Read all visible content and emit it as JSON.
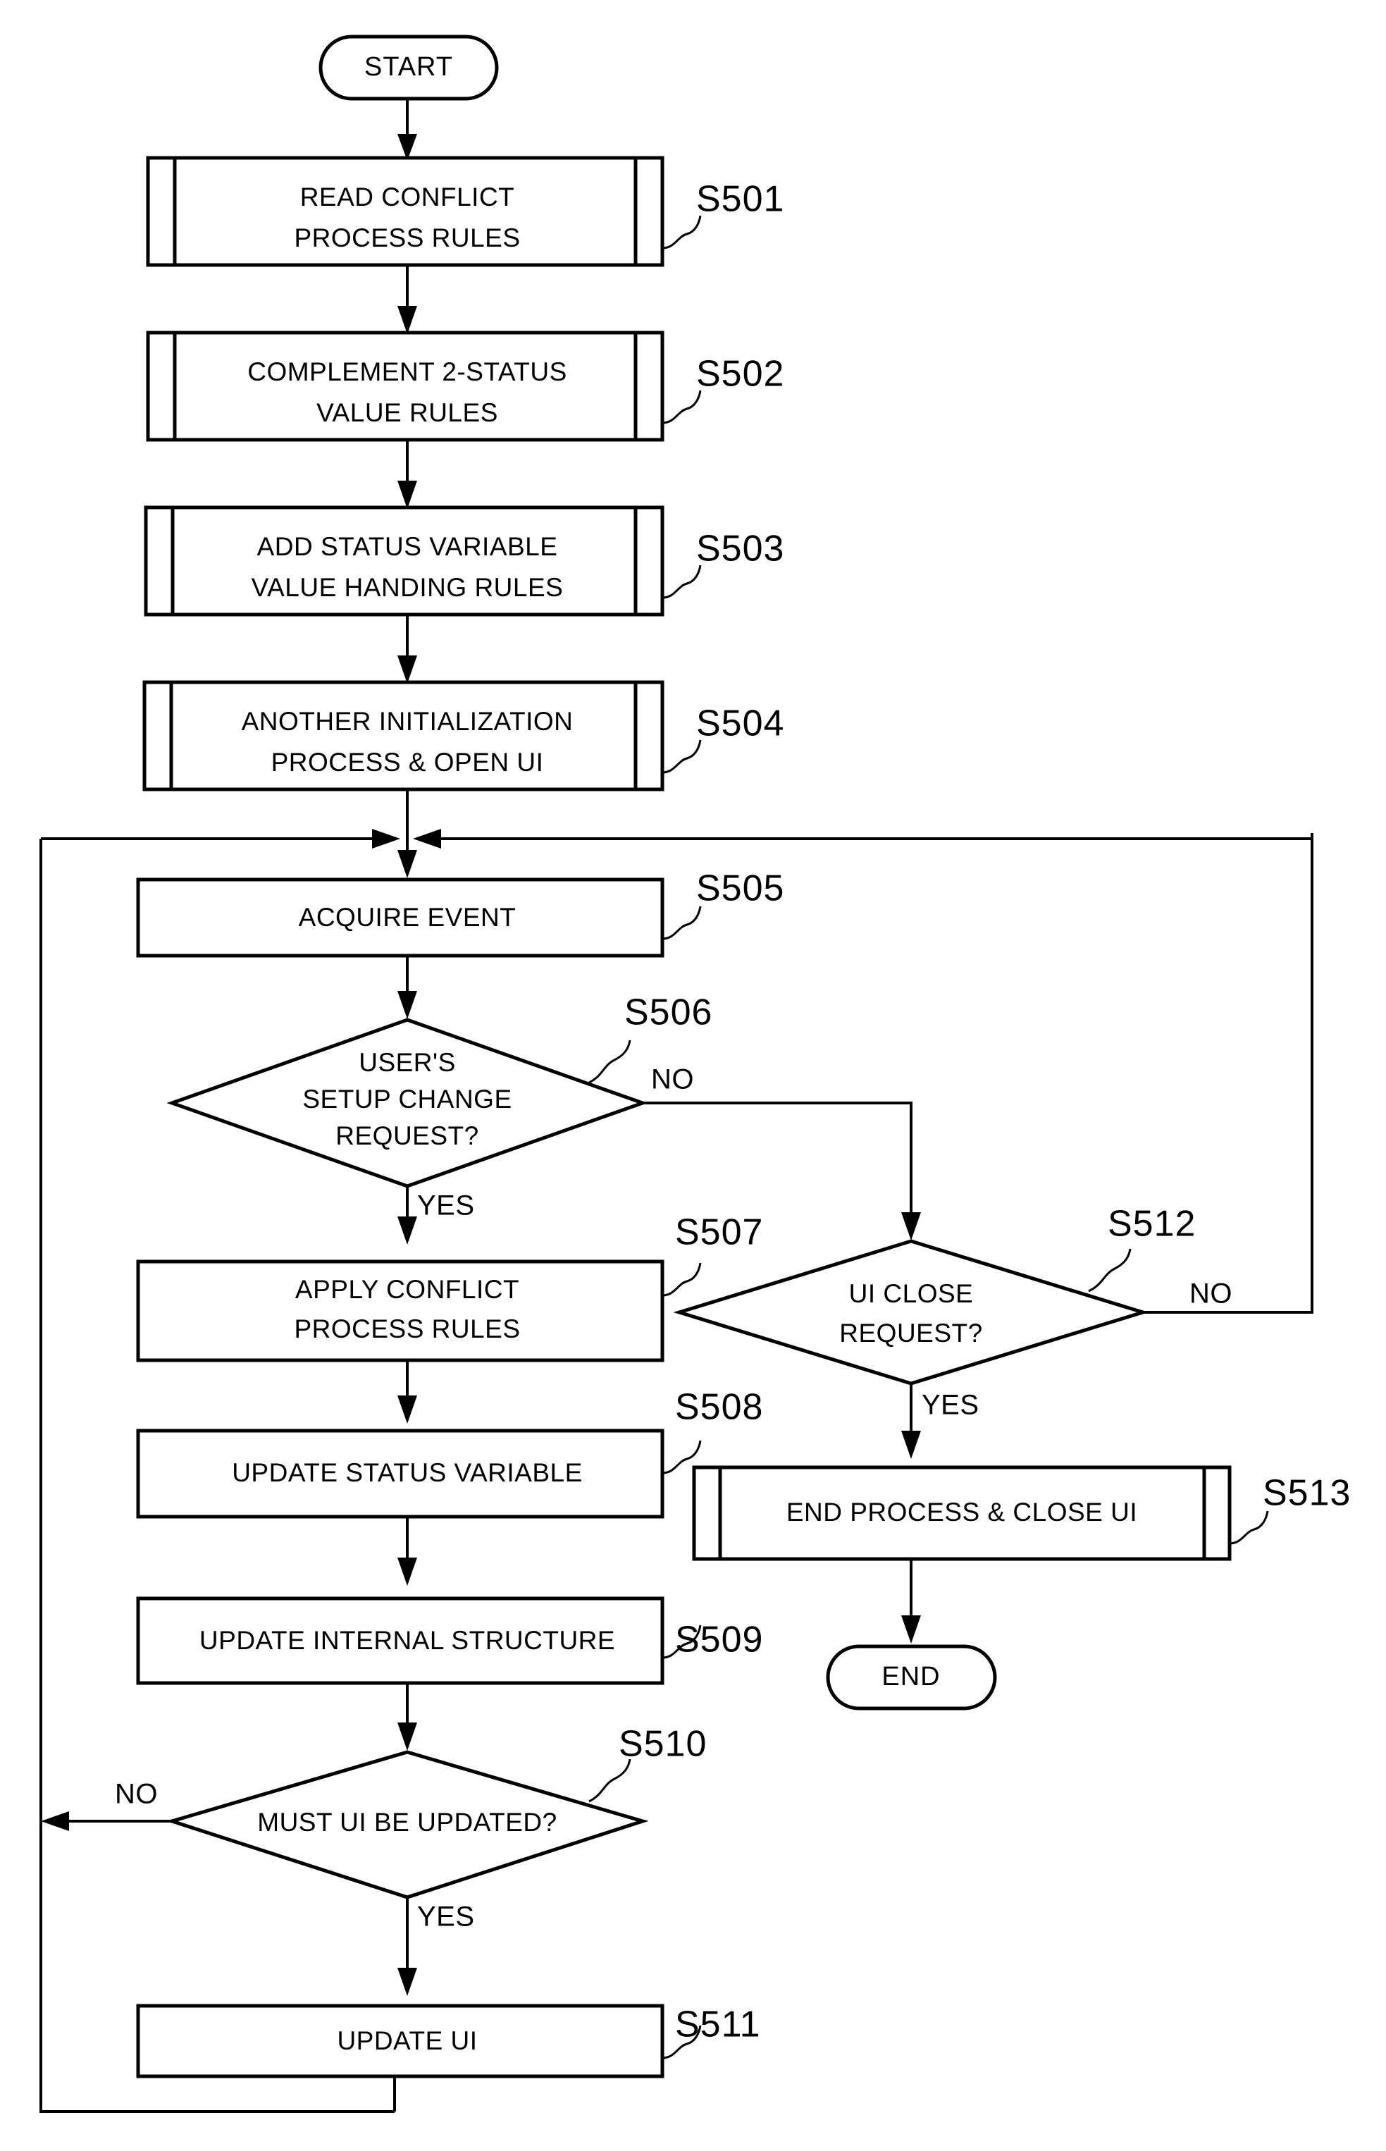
{
  "diagram": {
    "type": "flowchart",
    "orientation": "vertical",
    "terminators": {
      "start": "START",
      "end": "END"
    },
    "steps": [
      {
        "id": "S501",
        "ref": "S501",
        "shape": "predefined-process",
        "lines": [
          "READ CONFLICT",
          "PROCESS RULES"
        ]
      },
      {
        "id": "S502",
        "ref": "S502",
        "shape": "predefined-process",
        "lines": [
          "COMPLEMENT 2-STATUS",
          "VALUE RULES"
        ]
      },
      {
        "id": "S503",
        "ref": "S503",
        "shape": "predefined-process",
        "lines": [
          "ADD STATUS VARIABLE",
          "VALUE HANDING RULES"
        ]
      },
      {
        "id": "S504",
        "ref": "S504",
        "shape": "predefined-process",
        "lines": [
          "ANOTHER INITIALIZATION",
          "PROCESS & OPEN UI"
        ]
      },
      {
        "id": "S505",
        "ref": "S505",
        "shape": "process",
        "lines": [
          "ACQUIRE EVENT"
        ]
      },
      {
        "id": "S506",
        "ref": "S506",
        "shape": "decision",
        "lines": [
          "USER'S",
          "SETUP CHANGE",
          "REQUEST?"
        ]
      },
      {
        "id": "S507",
        "ref": "S507",
        "shape": "process",
        "lines": [
          "APPLY CONFLICT",
          "PROCESS RULES"
        ]
      },
      {
        "id": "S508",
        "ref": "S508",
        "shape": "process",
        "lines": [
          "UPDATE STATUS VARIABLE"
        ]
      },
      {
        "id": "S509",
        "ref": "S509",
        "shape": "process",
        "lines": [
          "UPDATE INTERNAL STRUCTURE"
        ]
      },
      {
        "id": "S510",
        "ref": "S510",
        "shape": "decision",
        "lines": [
          "MUST UI BE UPDATED?"
        ]
      },
      {
        "id": "S511",
        "ref": "S511",
        "shape": "process",
        "lines": [
          "UPDATE UI"
        ]
      },
      {
        "id": "S512",
        "ref": "S512",
        "shape": "decision",
        "lines": [
          "UI CLOSE",
          "REQUEST?"
        ]
      },
      {
        "id": "S513",
        "ref": "S513",
        "shape": "predefined-process",
        "lines": [
          "END PROCESS & CLOSE UI"
        ]
      }
    ],
    "branch_labels": {
      "s506_no": "NO",
      "s506_yes": "YES",
      "s510_no": "NO",
      "s510_yes": "YES",
      "s512_no": "NO",
      "s512_yes": "YES"
    },
    "colors": {
      "stroke": "#000000",
      "fill": "#ffffff",
      "background": "#ffffff"
    }
  }
}
